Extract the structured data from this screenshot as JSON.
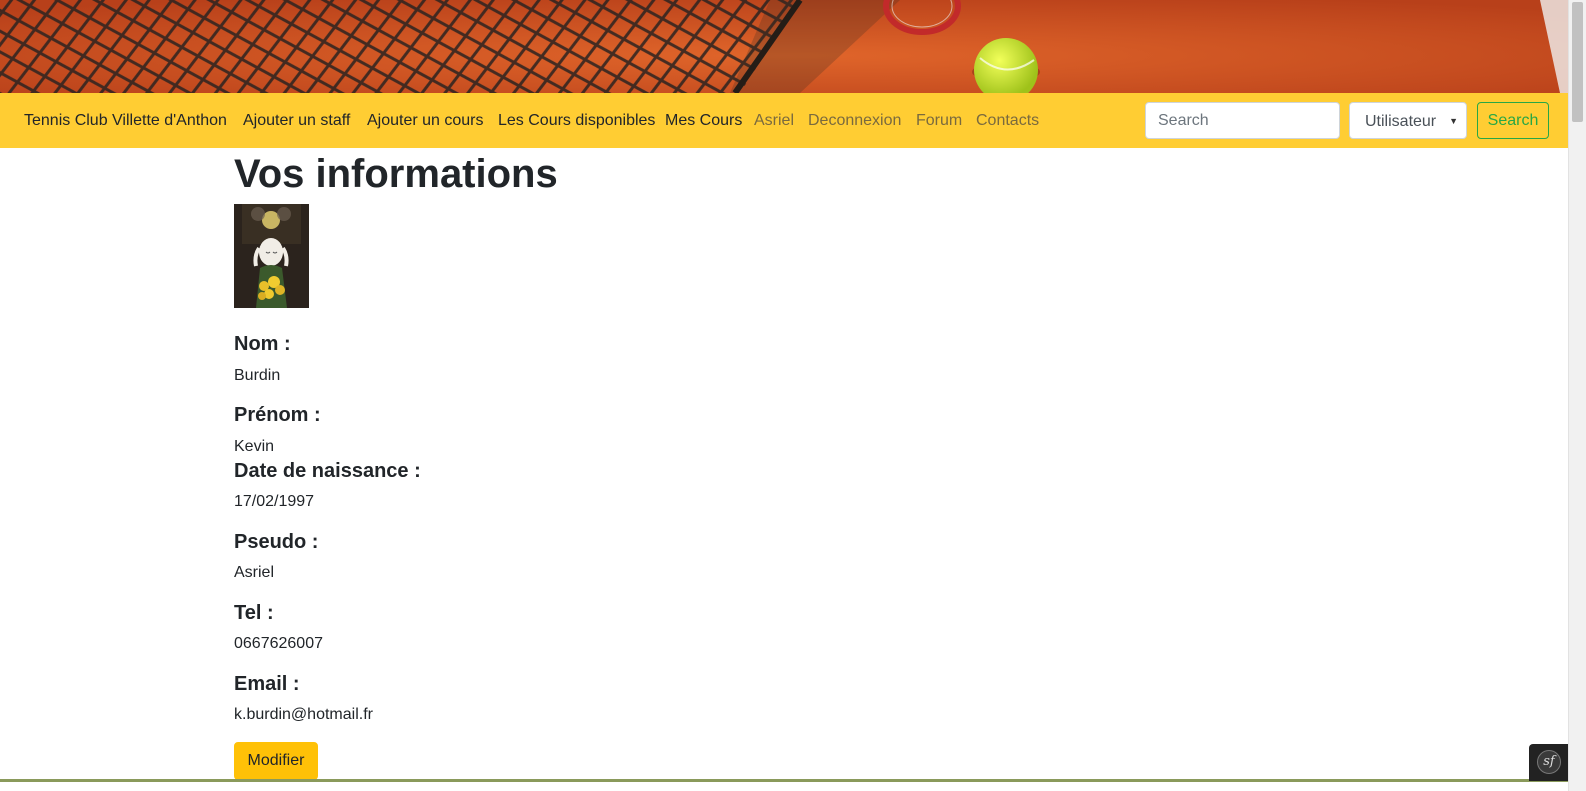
{
  "navbar": {
    "brand": "Tennis Club Villette d'Anthon",
    "links": [
      "Ajouter un staff",
      "Ajouter un cours",
      "Les Cours disponibles",
      "Mes Cours",
      "Asriel",
      "Deconnexion",
      "Forum",
      "Contacts"
    ],
    "search_placeholder": "Search",
    "select_value": "Utilisateur",
    "search_button": "Search",
    "colors": {
      "background": "#ffcd33",
      "search_button": "#28a745"
    }
  },
  "main": {
    "title": "Vos informations",
    "avatar_icon": "profile-picture",
    "fields": [
      {
        "label": "Nom :",
        "value": "Burdin"
      },
      {
        "label": "Prénom :",
        "value": "Kevin"
      },
      {
        "label": "Date de naissance :",
        "value": "17/02/1997"
      },
      {
        "label": "Pseudo :",
        "value": "Asriel"
      },
      {
        "label": "Tel :",
        "value": "0667626007"
      },
      {
        "label": "Email :",
        "value": "k.burdin@hotmail.fr"
      }
    ],
    "modify_button": "Modifier",
    "colors": {
      "modify_button": "#ffc107"
    }
  },
  "debug_toolbar": {
    "icon": "symfony-icon",
    "logo_text": "sf"
  }
}
